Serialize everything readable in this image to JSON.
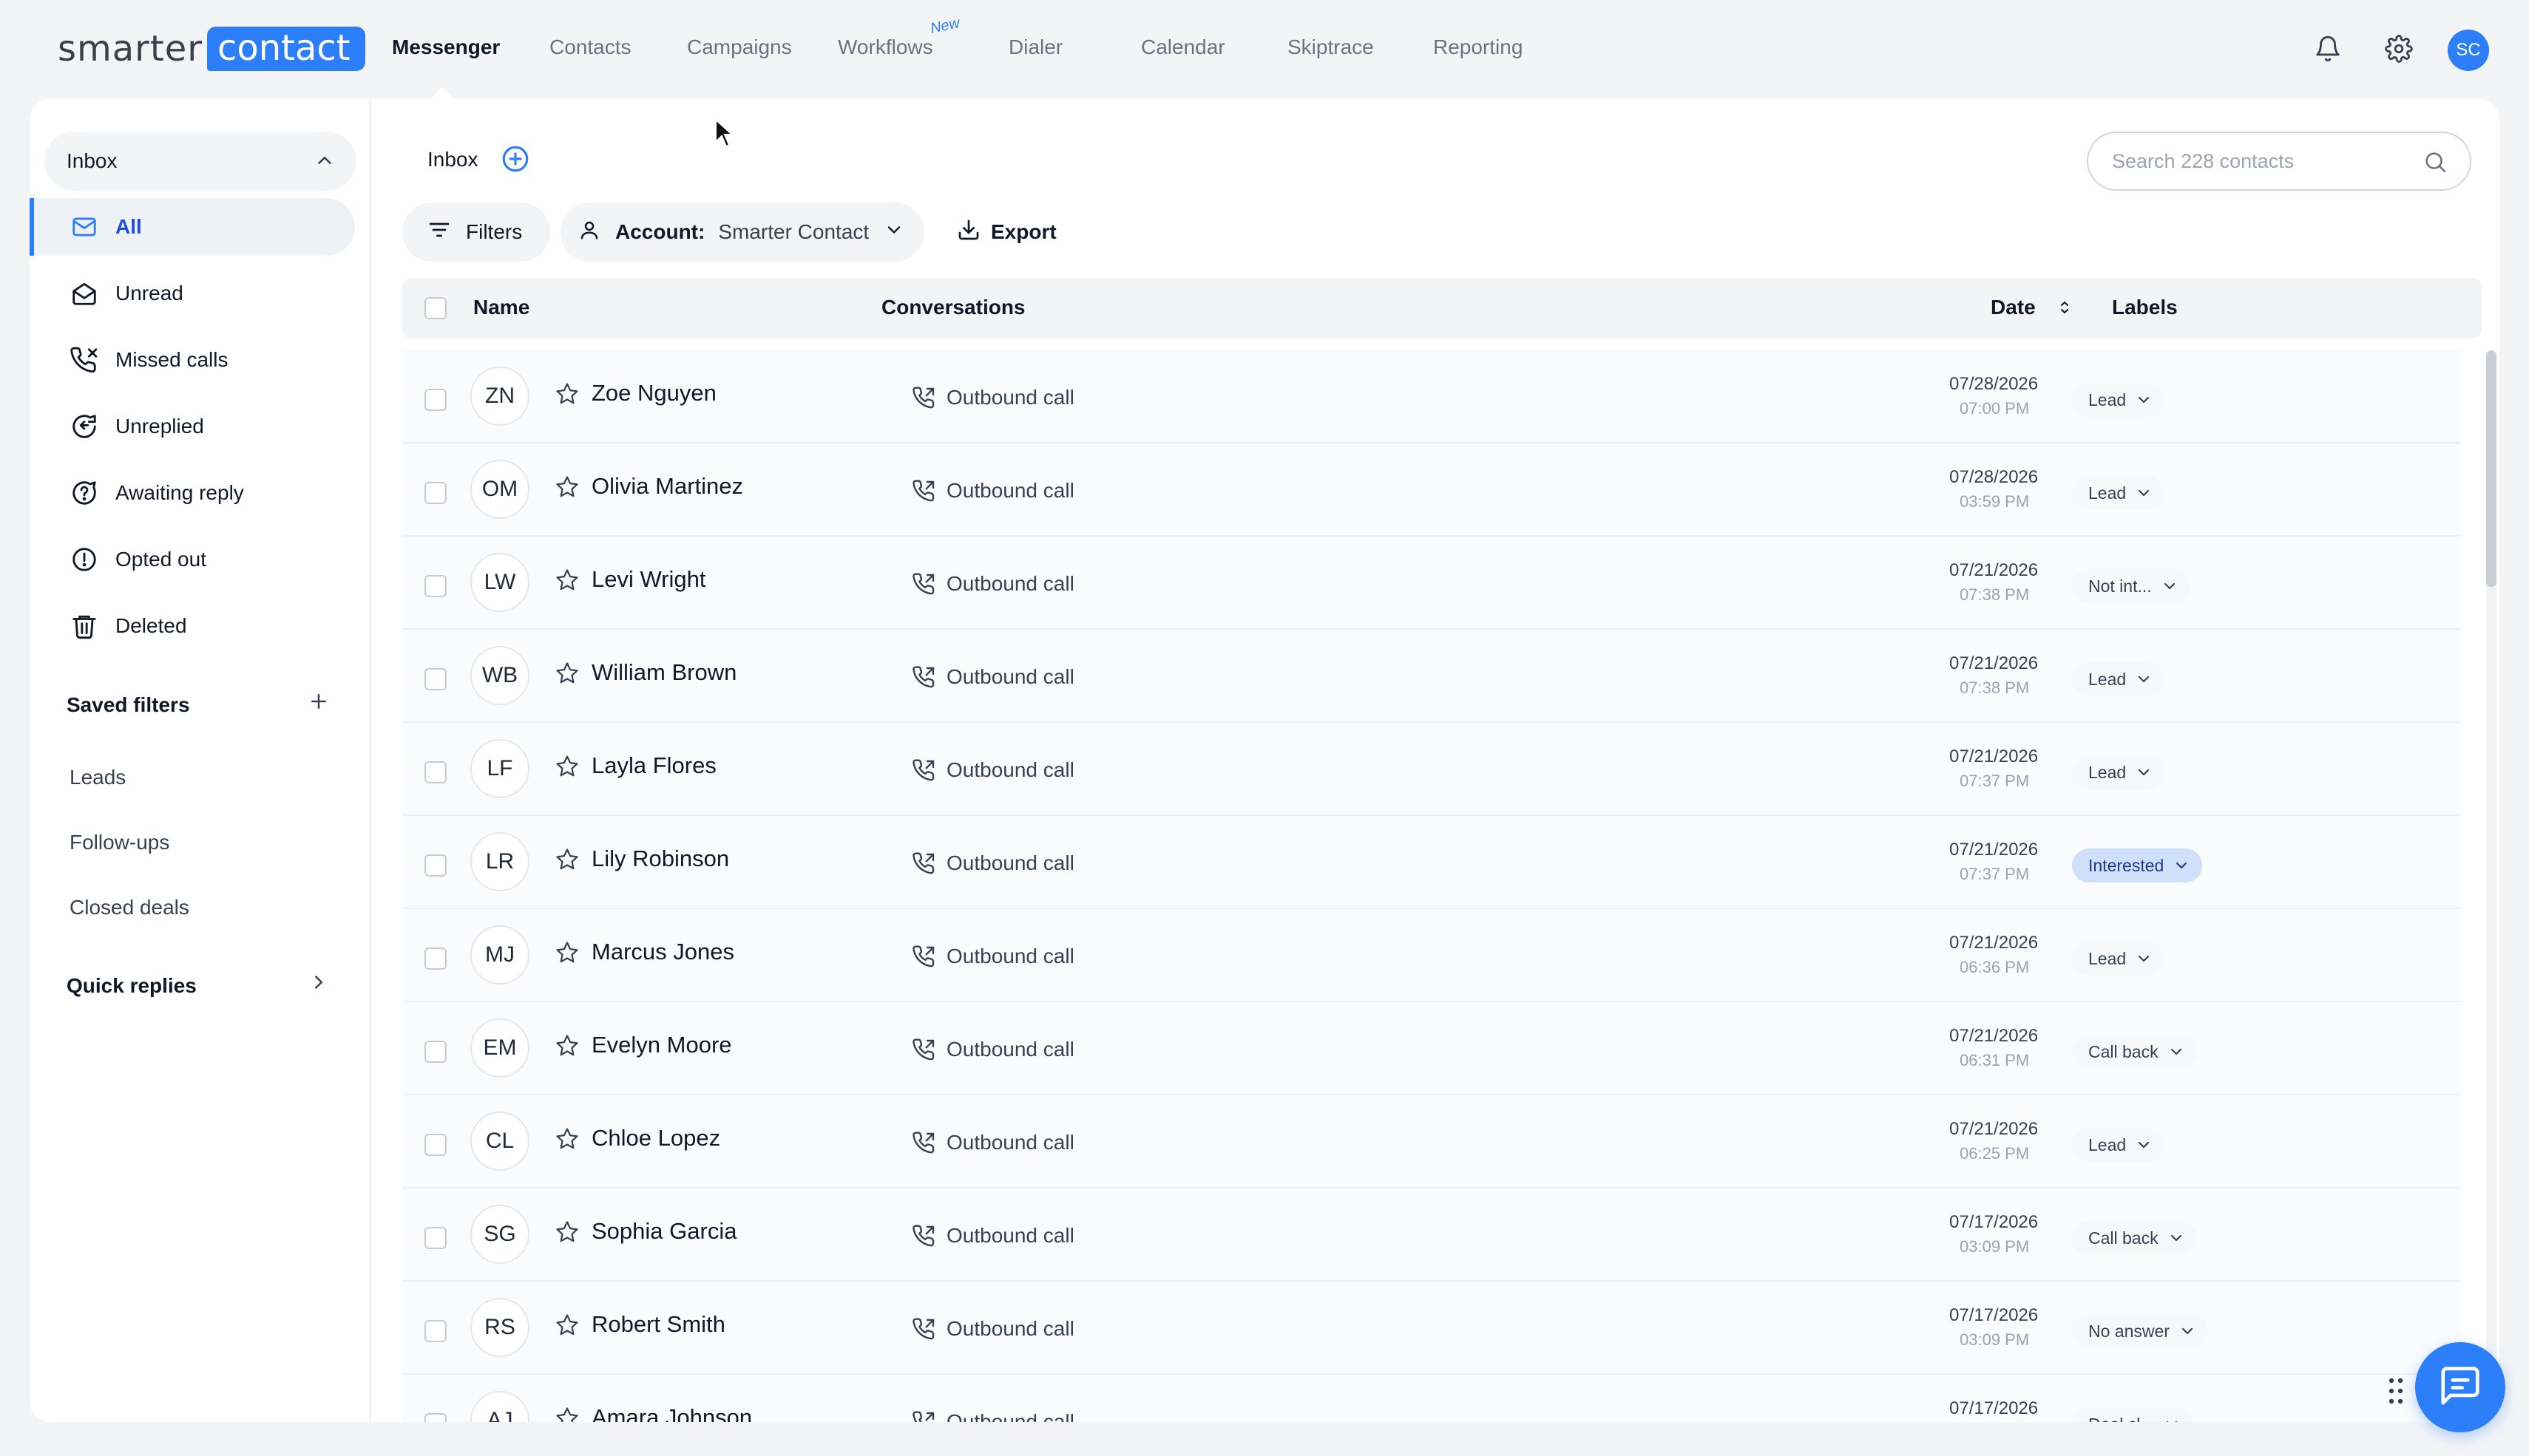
{
  "brand": {
    "part1": "smarter",
    "part2": "contact"
  },
  "nav": {
    "items": [
      "Messenger",
      "Contacts",
      "Campaigns",
      "Workflows",
      "Dialer",
      "Calendar",
      "Skiptrace",
      "Reporting"
    ],
    "active": "Messenger",
    "new_badge": "New"
  },
  "user": {
    "initials": "SC"
  },
  "sidebar": {
    "inbox_label": "Inbox",
    "items": [
      {
        "label": "All",
        "icon": "mail-icon"
      },
      {
        "label": "Unread",
        "icon": "envelope-open-icon"
      },
      {
        "label": "Missed calls",
        "icon": "missed-call-icon"
      },
      {
        "label": "Unreplied",
        "icon": "reply-icon"
      },
      {
        "label": "Awaiting reply",
        "icon": "question-bubble-icon"
      },
      {
        "label": "Opted out",
        "icon": "alert-circle-icon"
      },
      {
        "label": "Deleted",
        "icon": "trash-icon"
      }
    ],
    "saved_filters_label": "Saved filters",
    "saved_filters": [
      "Leads",
      "Follow-ups",
      "Closed deals"
    ],
    "quick_replies_label": "Quick replies"
  },
  "content": {
    "title": "Inbox",
    "search_placeholder": "Search 228 contacts",
    "filters_label": "Filters",
    "account_key": "Account:",
    "account_value": "Smarter Contact",
    "export_label": "Export",
    "columns": {
      "name": "Name",
      "conversations": "Conversations",
      "date": "Date",
      "labels": "Labels"
    }
  },
  "rows": [
    {
      "initials": "ZN",
      "name": "Zoe Nguyen",
      "conv": "Outbound call",
      "date": "07/28/2026",
      "time": "07:00 PM",
      "label": "Lead"
    },
    {
      "initials": "OM",
      "name": "Olivia Martinez",
      "conv": "Outbound call",
      "date": "07/28/2026",
      "time": "03:59 PM",
      "label": "Lead"
    },
    {
      "initials": "LW",
      "name": "Levi Wright",
      "conv": "Outbound call",
      "date": "07/21/2026",
      "time": "07:38 PM",
      "label": "Not int..."
    },
    {
      "initials": "WB",
      "name": "William Brown",
      "conv": "Outbound call",
      "date": "07/21/2026",
      "time": "07:38 PM",
      "label": "Lead"
    },
    {
      "initials": "LF",
      "name": "Layla Flores",
      "conv": "Outbound call",
      "date": "07/21/2026",
      "time": "07:37 PM",
      "label": "Lead"
    },
    {
      "initials": "LR",
      "name": "Lily Robinson",
      "conv": "Outbound call",
      "date": "07/21/2026",
      "time": "07:37 PM",
      "label": "Interested",
      "highlight": true
    },
    {
      "initials": "MJ",
      "name": "Marcus Jones",
      "conv": "Outbound call",
      "date": "07/21/2026",
      "time": "06:36 PM",
      "label": "Lead"
    },
    {
      "initials": "EM",
      "name": "Evelyn Moore",
      "conv": "Outbound call",
      "date": "07/21/2026",
      "time": "06:31 PM",
      "label": "Call back"
    },
    {
      "initials": "CL",
      "name": "Chloe Lopez",
      "conv": "Outbound call",
      "date": "07/21/2026",
      "time": "06:25 PM",
      "label": "Lead"
    },
    {
      "initials": "SG",
      "name": "Sophia Garcia",
      "conv": "Outbound call",
      "date": "07/17/2026",
      "time": "03:09 PM",
      "label": "Call back"
    },
    {
      "initials": "RS",
      "name": "Robert Smith",
      "conv": "Outbound call",
      "date": "07/17/2026",
      "time": "03:09 PM",
      "label": "No answer"
    },
    {
      "initials": "AJ",
      "name": "Amara Johnson",
      "conv": "Outbound call",
      "date": "07/17/2026",
      "time": "",
      "label": "Deal cl..."
    }
  ],
  "colors": {
    "accent": "#2d7ff9",
    "highlight_label": "#cfe0fb"
  }
}
